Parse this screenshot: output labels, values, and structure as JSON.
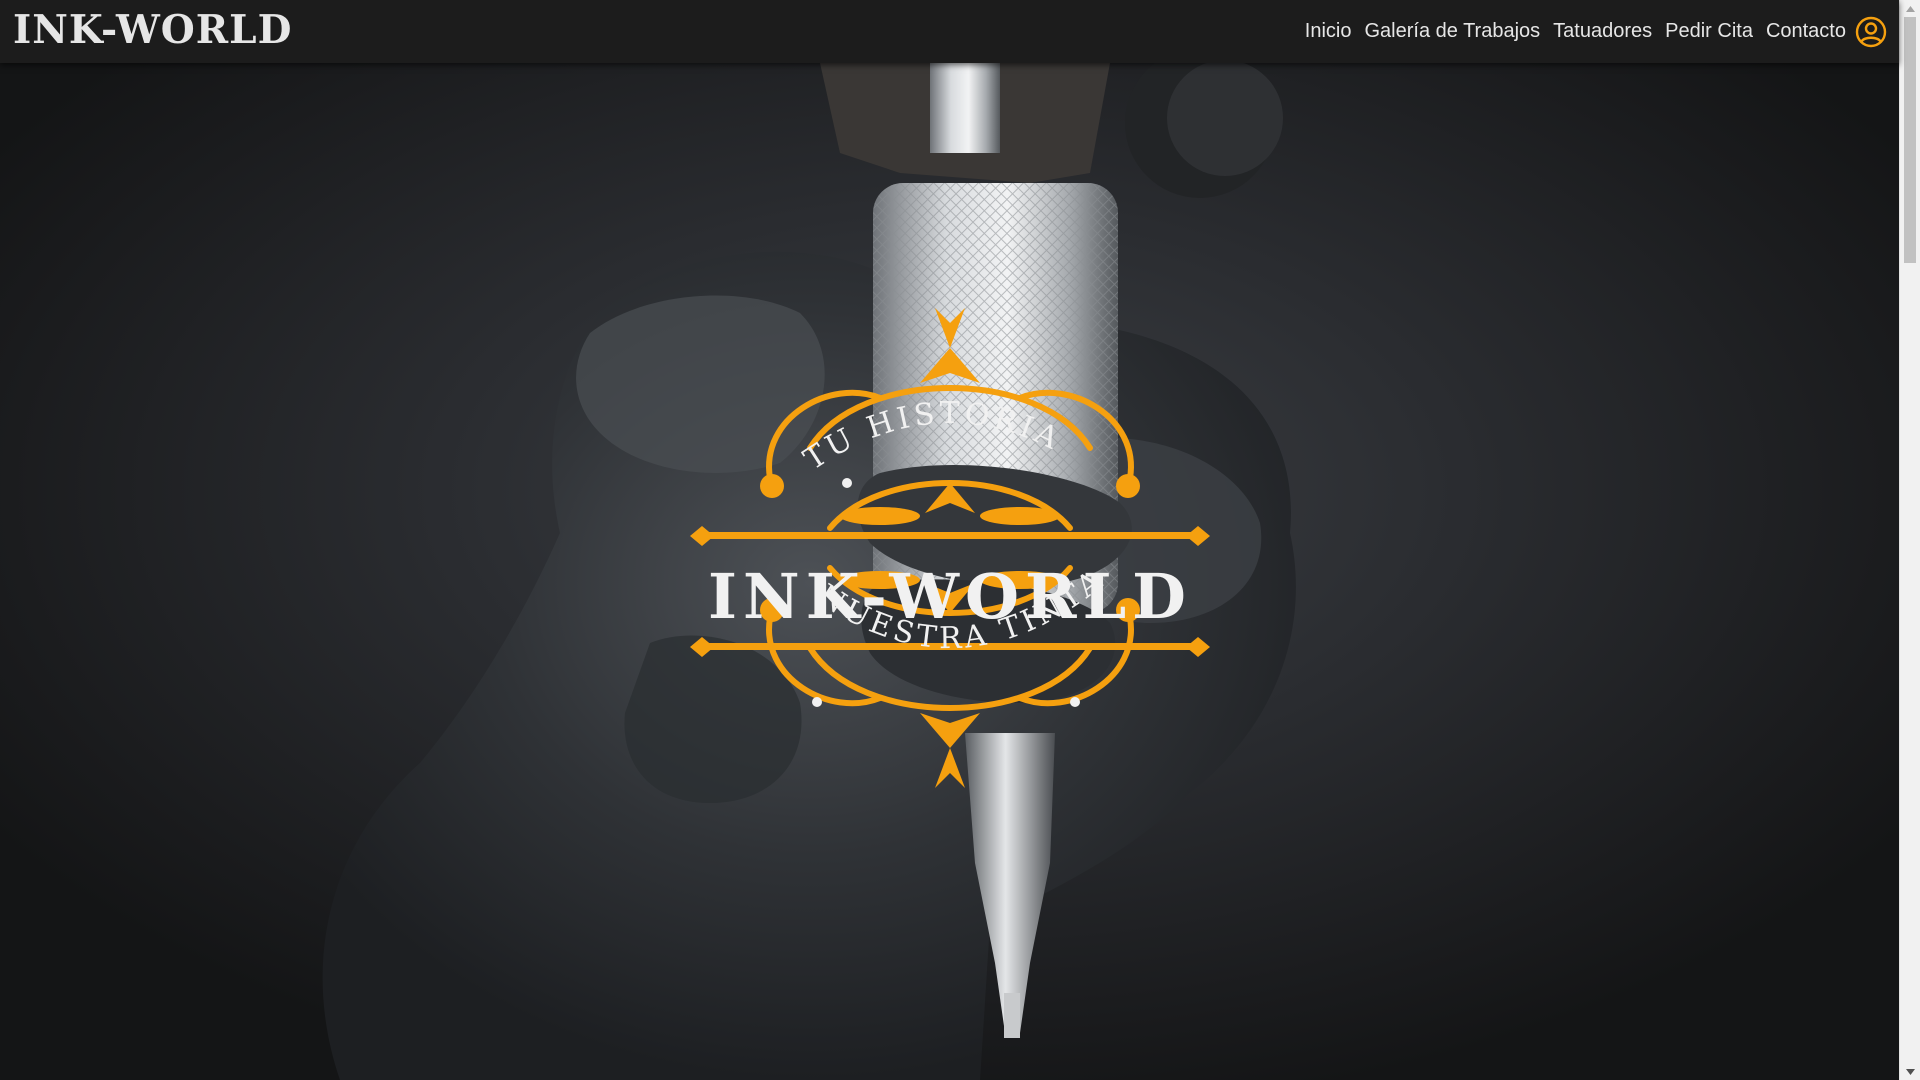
{
  "brand": {
    "name": "INK-WORLD"
  },
  "nav": {
    "items": [
      {
        "label": "Inicio"
      },
      {
        "label": "Galería de Trabajos"
      },
      {
        "label": "Tatuadores"
      },
      {
        "label": "Pedir Cita"
      },
      {
        "label": "Contacto"
      }
    ],
    "user_icon": "user-circle-icon"
  },
  "hero": {
    "emblem": {
      "top_text": "TU HISTORIA",
      "title": "INK-WORLD",
      "bottom_text": "NUESTRA TINTA"
    }
  },
  "colors": {
    "accent": "#f5a00f",
    "nav_bg": "#1c1c1c",
    "nav_text": "#e6e6e6"
  }
}
